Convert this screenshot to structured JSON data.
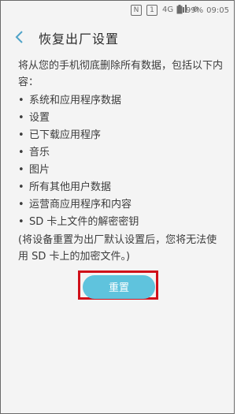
{
  "status_bar": {
    "network_text": "4G",
    "battery_percent": "99%",
    "time": "09:05",
    "icons": [
      "nfc-icon",
      "sim1-icon",
      "signal-icon",
      "settings-icon",
      "battery-icon"
    ]
  },
  "header": {
    "back_icon": "chevron-left-icon",
    "title": "恢复出厂设置"
  },
  "content": {
    "intro": "将从您的手机彻底删除所有数据，包括以下内容：",
    "items": [
      "系统和应用程序数据",
      "设置",
      "已下载应用程序",
      "音乐",
      "图片",
      "所有其他用户数据",
      "运营商应用程序和内容",
      "SD 卡上文件的解密密钥"
    ],
    "note": "(将设备重置为出厂默认设置后，您将无法使用 SD 卡上的加密文件。)"
  },
  "actions": {
    "reset_label": "重置"
  },
  "colors": {
    "accent": "#5fc3dd",
    "highlight": "#d0101a",
    "back_arrow": "#4fa3c8"
  }
}
